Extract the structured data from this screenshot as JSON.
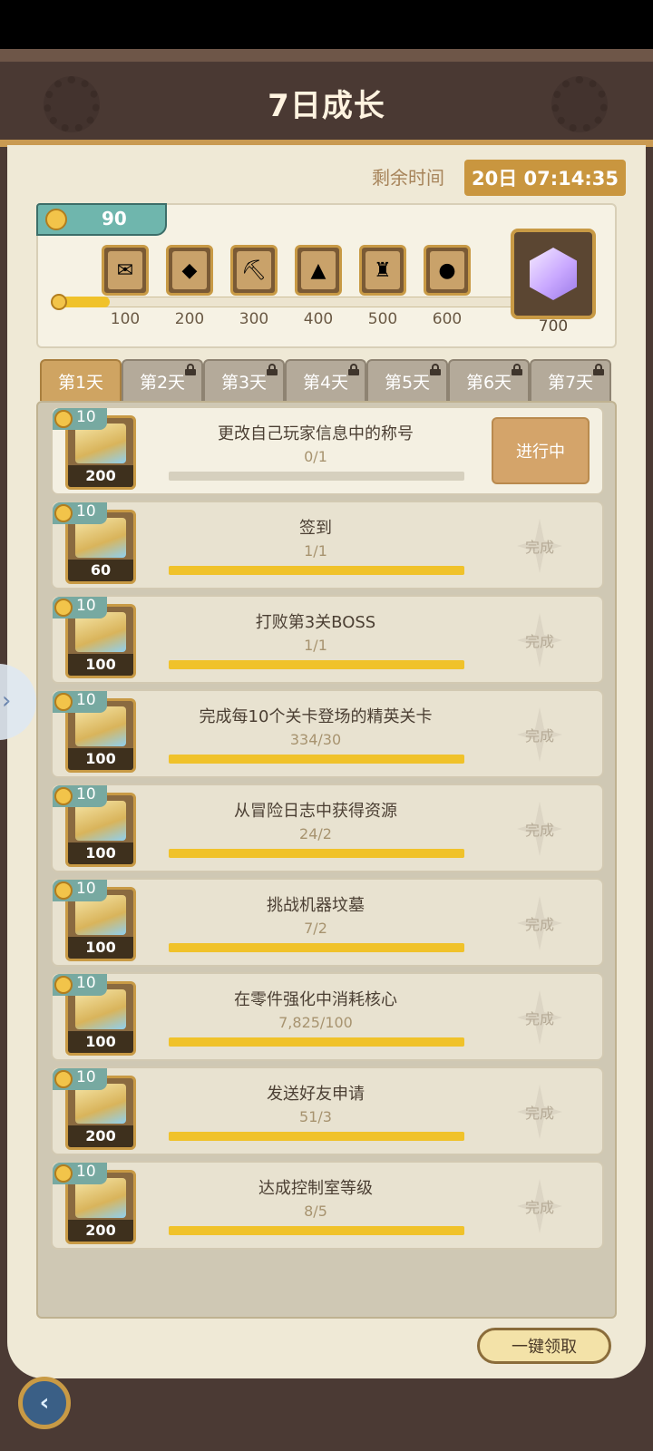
{
  "header": {
    "title": "7日成长"
  },
  "timer": {
    "label": "剩余时间",
    "value": "20日 07:14:35"
  },
  "points": {
    "value": "90",
    "progress_fraction": 0.115
  },
  "milestones": [
    {
      "threshold": "100",
      "icon": "ticket-icon"
    },
    {
      "threshold": "200",
      "icon": "crystal-icon"
    },
    {
      "threshold": "300",
      "icon": "pickaxe-icon"
    },
    {
      "threshold": "400",
      "icon": "gold-box-icon"
    },
    {
      "threshold": "500",
      "icon": "rank-box-icon"
    },
    {
      "threshold": "600",
      "icon": "egg-box-icon"
    }
  ],
  "final_reward": {
    "threshold": "700",
    "icon": "big-crystal-icon"
  },
  "tabs": [
    {
      "label": "第1天",
      "active": true,
      "locked": false
    },
    {
      "label": "第2天",
      "active": false,
      "locked": true
    },
    {
      "label": "第3天",
      "active": false,
      "locked": true
    },
    {
      "label": "第4天",
      "active": false,
      "locked": true
    },
    {
      "label": "第5天",
      "active": false,
      "locked": true
    },
    {
      "label": "第6天",
      "active": false,
      "locked": true
    },
    {
      "label": "第7天",
      "active": false,
      "locked": true
    }
  ],
  "tasks": [
    {
      "points": "10",
      "reward": "200",
      "name": "更改自己玩家信息中的称号",
      "count": "0/1",
      "progress": 0,
      "status": "进行中",
      "in_progress": true
    },
    {
      "points": "10",
      "reward": "60",
      "name": "签到",
      "count": "1/1",
      "progress": 1,
      "status": "完成",
      "in_progress": false
    },
    {
      "points": "10",
      "reward": "100",
      "name": "打败第3关BOSS",
      "count": "1/1",
      "progress": 1,
      "status": "完成",
      "in_progress": false
    },
    {
      "points": "10",
      "reward": "100",
      "name": "完成每10个关卡登场的精英关卡",
      "count": "334/30",
      "progress": 1,
      "status": "完成",
      "in_progress": false
    },
    {
      "points": "10",
      "reward": "100",
      "name": "从冒险日志中获得资源",
      "count": "24/2",
      "progress": 1,
      "status": "完成",
      "in_progress": false
    },
    {
      "points": "10",
      "reward": "100",
      "name": "挑战机器坟墓",
      "count": "7/2",
      "progress": 1,
      "status": "完成",
      "in_progress": false
    },
    {
      "points": "10",
      "reward": "100",
      "name": "在零件强化中消耗核心",
      "count": "7,825/100",
      "progress": 1,
      "status": "完成",
      "in_progress": false
    },
    {
      "points": "10",
      "reward": "200",
      "name": "发送好友申请",
      "count": "51/3",
      "progress": 1,
      "status": "完成",
      "in_progress": false
    },
    {
      "points": "10",
      "reward": "200",
      "name": "达成控制室等级",
      "count": "8/5",
      "progress": 1,
      "status": "完成",
      "in_progress": false
    }
  ],
  "actions": {
    "claim_all": "一键领取"
  }
}
